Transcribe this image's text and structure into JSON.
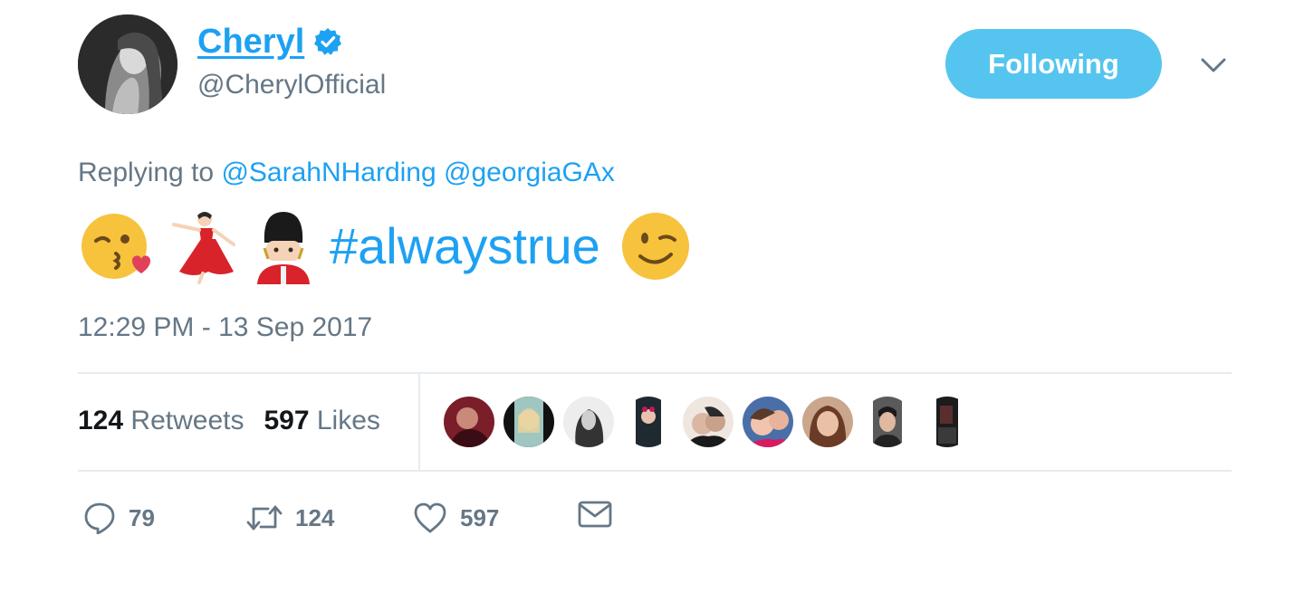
{
  "author": {
    "name": "Cheryl",
    "handle": "@CherylOfficial",
    "verified": true
  },
  "follow_button": {
    "label": "Following"
  },
  "reply": {
    "prefix": "Replying to",
    "mentions": [
      "@SarahNHarding",
      "@georgiaGAx"
    ]
  },
  "content": {
    "emoji_before": [
      "kissing-face-icon",
      "dancer-icon",
      "guardsman-icon"
    ],
    "hashtag": "#alwaystrue",
    "emoji_after": [
      "winking-face-icon"
    ]
  },
  "timestamp": "12:29 PM - 13 Sep 2017",
  "stats": {
    "retweets": {
      "count": "124",
      "label": "Retweets"
    },
    "likes": {
      "count": "597",
      "label": "Likes"
    },
    "liker_avatar_count": 9
  },
  "actions": {
    "reply_count": "79",
    "retweet_count": "124",
    "like_count": "597"
  },
  "colors": {
    "accent": "#1da1f2",
    "follow_button": "#55c5ef",
    "muted_text": "#657786",
    "divider": "#e6ecf0"
  }
}
